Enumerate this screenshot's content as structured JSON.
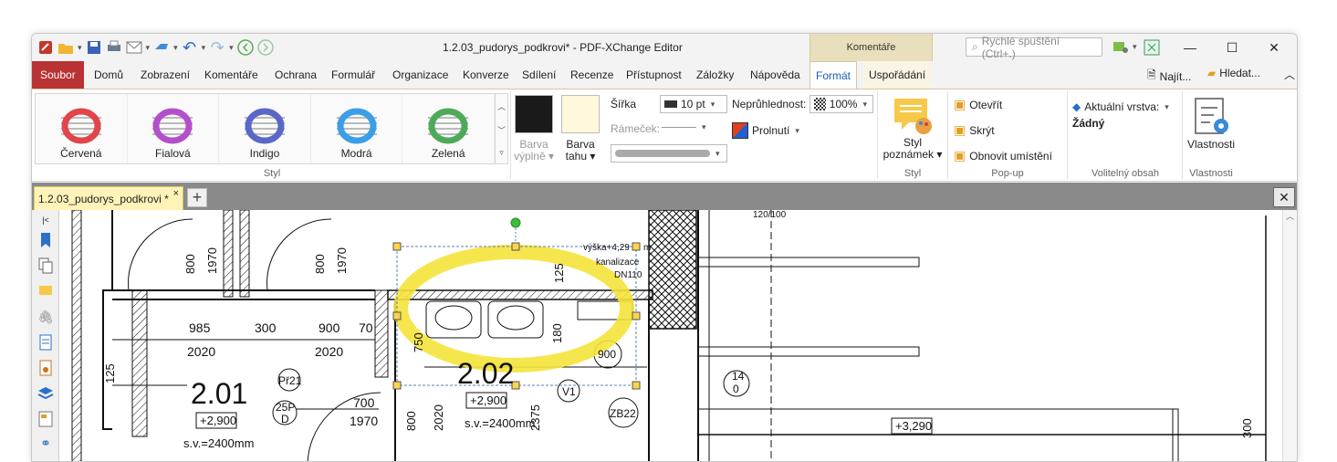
{
  "window": {
    "title": "1.2.03_pudorys_podkrovi* - PDF-XChange Editor",
    "context_tab_header": "Komentáře",
    "search_placeholder": "Rychlé spuštění (Ctrl+.)"
  },
  "menus": [
    "Soubor",
    "Domů",
    "Zobrazení",
    "Komentáře",
    "Ochrana",
    "Formulář",
    "Organizace",
    "Konverze",
    "Sdílení",
    "Recenze",
    "Přístupnost",
    "Záložky",
    "Nápověda",
    "Formát",
    "Uspořádání"
  ],
  "menu_right": {
    "find": "Najít...",
    "search": "Hledat..."
  },
  "ribbon": {
    "gallery": [
      {
        "label": "Červená",
        "color": "#e0454c"
      },
      {
        "label": "Fialová",
        "color": "#b44fcb"
      },
      {
        "label": "Indigo",
        "color": "#5a67c8"
      },
      {
        "label": "Modrá",
        "color": "#3a9fe6"
      },
      {
        "label": "Zelená",
        "color": "#4daa59"
      }
    ],
    "style_group": "Styl",
    "fill_color_label_1": "Barva",
    "fill_color_label_2": "výplně",
    "stroke_color_label_1": "Barva",
    "stroke_color_label_2": "tahu",
    "fill_color": "#1a1a1a",
    "stroke_color": "#fff8dc",
    "width_label": "Šířka",
    "width_value": "10 pt",
    "border_label": "Rámeček:",
    "opacity_label": "Neprůhlednost:",
    "opacity_value": "100%",
    "blend_label": "Prolnutí",
    "note_style_1": "Styl",
    "note_style_2": "poznámek",
    "note_group": "Styl",
    "open": "Otevřít",
    "hide": "Skrýt",
    "restore": "Obnovit umístění",
    "popup_group": "Pop-up",
    "layer_label": "Aktuální vrstva:",
    "layer_value": "Žádný",
    "optional_group": "Volitelný obsah",
    "properties": "Vlastnosti",
    "properties_group": "Vlastnosti"
  },
  "tabs": {
    "doc": "1.2.03_pudorys_podkrovi *",
    "close": "×",
    "new": "+"
  },
  "drawing": {
    "t_800a": "800",
    "t_1970a": "1970",
    "t_800b": "800",
    "t_1970b": "1970",
    "t_985": "985",
    "t_300": "300",
    "t_900": "900",
    "t_70": "70",
    "t_2020a": "2020",
    "t_2020b": "2020",
    "t_125a": "125",
    "t_125b": "125",
    "t_201": "2.01",
    "t_202": "2.02",
    "t_2900a": "+2,900",
    "t_2900b": "+2,900",
    "t_sv1": "s.v.=2400mm",
    "t_sv2": "s.v.=2400mm",
    "t_pr21": "Př21",
    "t_25p": "25P",
    "t_d": "D",
    "t_700": "700",
    "t_1970c": "1970",
    "t_800c": "800",
    "t_2020c": "2020",
    "t_2375": "2375",
    "t_750": "750",
    "t_180": "180",
    "t_900z": "900",
    "t_v1": "V1",
    "t_zb22": "ZB22",
    "t_14": "14",
    "t_0": "0",
    "t_3290": "+3,290",
    "t_300v": "300",
    "t_vyska": "výška+4,29",
    "t_m": "m",
    "t_kanal": "kanalizace",
    "t_dn": "DN110",
    "t_12010": "120/100"
  }
}
